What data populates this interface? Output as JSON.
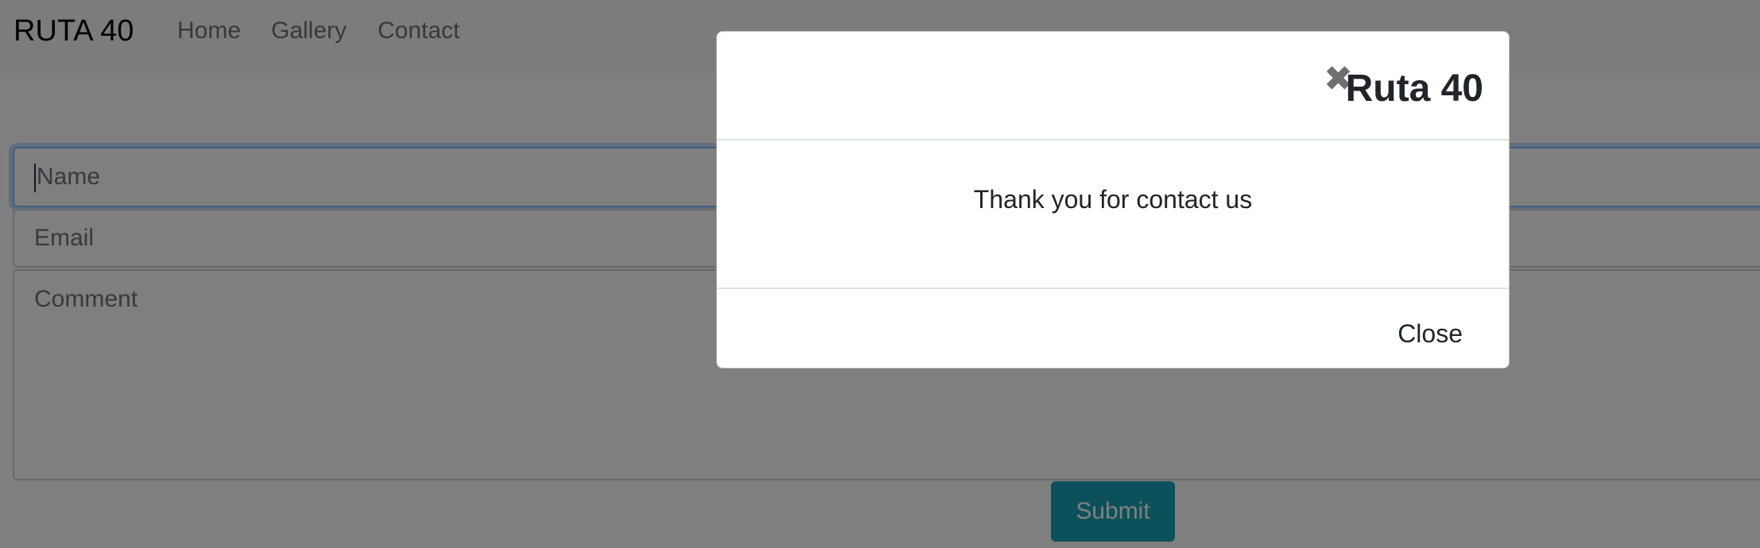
{
  "navbar": {
    "brand": "RUTA 40",
    "links": [
      "Home",
      "Gallery",
      "Contact"
    ]
  },
  "form": {
    "name_placeholder": "Name",
    "email_placeholder": "Email",
    "comment_placeholder": "Comment",
    "submit_label": "Submit"
  },
  "modal": {
    "title": "Ruta 40",
    "close_icon": "close-icon",
    "message": "Thank you for contact us",
    "close_label": "Close"
  },
  "colors": {
    "submit_button": "#17a2b8",
    "backdrop": "rgba(0,0,0,0.5)",
    "focus_border": "#80bdff"
  }
}
